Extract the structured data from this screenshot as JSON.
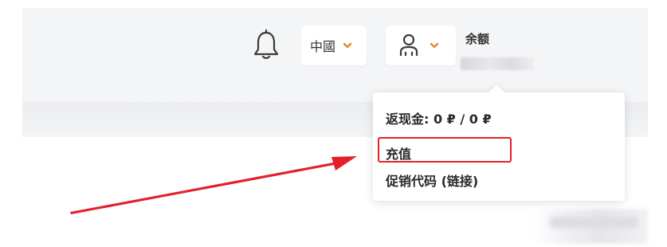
{
  "header": {
    "language": "中國",
    "balance_label": "余额",
    "notification_icon": "bell-icon",
    "user_icon": "user-icon",
    "chevron_icon": "chevron-down-icon",
    "chevron_color": "#e0892b"
  },
  "dropdown": {
    "cashback": "返现金: 0 ₽ / 0 ₽",
    "recharge": "充值",
    "promo": "促销代码 (链接)"
  },
  "annotation": {
    "highlight_color": "#e3202a",
    "arrow_color": "#e3202a"
  }
}
